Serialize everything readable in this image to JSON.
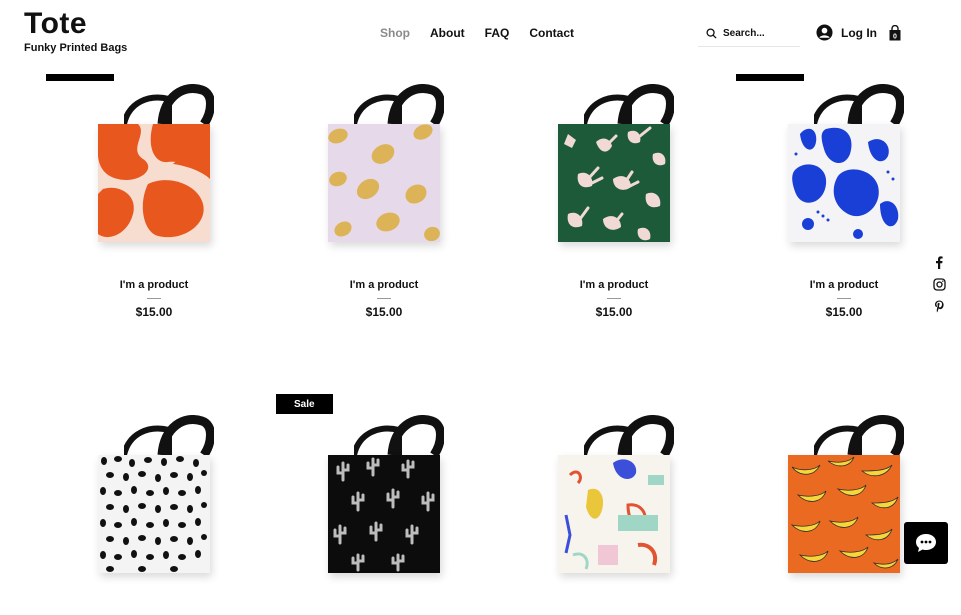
{
  "brand": {
    "title": "Tote",
    "subtitle": "Funky Printed Bags"
  },
  "nav": [
    {
      "label": "Shop",
      "active": true
    },
    {
      "label": "About"
    },
    {
      "label": "FAQ"
    },
    {
      "label": "Contact"
    }
  ],
  "search": {
    "placeholder": "Search...",
    "icon": "search-icon"
  },
  "account": {
    "login_label": "Log In",
    "icon": "user-icon"
  },
  "cart": {
    "icon": "shopping-bag-icon",
    "count": "0"
  },
  "social": [
    "facebook-icon",
    "instagram-icon",
    "pinterest-icon"
  ],
  "products": [
    {
      "name": "I'm a product",
      "price": "$15.00",
      "pattern": "orange-blobs"
    },
    {
      "name": "I'm a product",
      "price": "$15.00",
      "pattern": "lemons"
    },
    {
      "name": "I'm a product",
      "price": "$15.00",
      "pattern": "green-hands"
    },
    {
      "name": "I'm a product",
      "price": "$15.00",
      "pattern": "blue-blobs"
    },
    {
      "name": "",
      "price": "",
      "pattern": "black-dots"
    },
    {
      "name": "",
      "price": "",
      "pattern": "cactus",
      "ribbon": "Sale"
    },
    {
      "name": "",
      "price": "",
      "pattern": "pastel-abstract"
    },
    {
      "name": "",
      "price": "",
      "pattern": "bananas"
    }
  ],
  "chat": {
    "icon": "chat-icon"
  },
  "colors": {
    "accent": "#000000",
    "nav_active": "#8a8a8a"
  }
}
